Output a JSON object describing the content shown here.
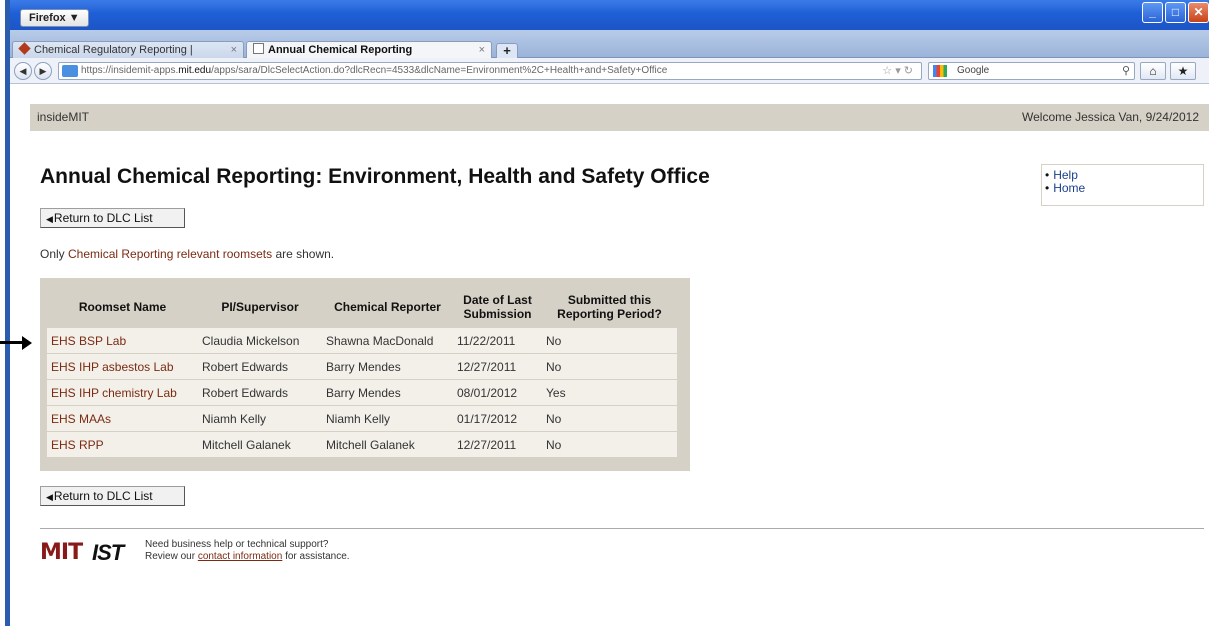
{
  "browser": {
    "menu_button": "Firefox ▼",
    "tabs": [
      {
        "label": "Chemical Regulatory Reporting |",
        "active": false
      },
      {
        "label": "Annual Chemical Reporting",
        "active": true
      }
    ],
    "new_tab": "+",
    "url_prefix": "https://insidemit-apps.",
    "url_host": "mit.edu",
    "url_path": "/apps/sara/DlcSelectAction.do?dlcRecn=4533&dlcName=Environment%2C+Health+and+Safety+Office",
    "search_engine": "Google"
  },
  "header": {
    "brand": "insideMIT",
    "welcome": "Welcome Jessica Van, 9/24/2012"
  },
  "page": {
    "title": "Annual Chemical Reporting: Environment, Health and Safety Office",
    "help_links": [
      "Help",
      "Home"
    ],
    "return_button": "Return to DLC List",
    "note_prefix": "Only ",
    "note_link": "Chemical Reporting relevant roomsets",
    "note_suffix": " are shown."
  },
  "table": {
    "headers": {
      "roomset": "Roomset Name",
      "pi": "PI/Supervisor",
      "reporter": "Chemical Reporter",
      "date_1": "Date of Last",
      "date_2": "Submission",
      "submitted_1": "Submitted this",
      "submitted_2": "Reporting Period?"
    },
    "rows": [
      {
        "roomset": "EHS BSP Lab",
        "pi": "Claudia Mickelson",
        "reporter": "Shawna MacDonald",
        "date": "11/22/2011",
        "submitted": "No"
      },
      {
        "roomset": "EHS IHP asbestos Lab",
        "pi": "Robert Edwards",
        "reporter": "Barry Mendes",
        "date": "12/27/2011",
        "submitted": "No"
      },
      {
        "roomset": "EHS IHP chemistry Lab",
        "pi": "Robert Edwards",
        "reporter": "Barry Mendes",
        "date": "08/01/2012",
        "submitted": "Yes"
      },
      {
        "roomset": "EHS MAAs",
        "pi": "Niamh Kelly",
        "reporter": "Niamh Kelly",
        "date": "01/17/2012",
        "submitted": "No"
      },
      {
        "roomset": "EHS RPP",
        "pi": "Mitchell Galanek",
        "reporter": "Mitchell Galanek",
        "date": "12/27/2011",
        "submitted": "No"
      }
    ]
  },
  "footer": {
    "mit_logo": "MIT",
    "ist_logo": "IST",
    "line1": "Need business help or technical support?",
    "line2_prefix": "Review our ",
    "line2_link": "contact information",
    "line2_suffix": " for assistance."
  },
  "colors": {
    "header_bg": "#d6d1c6",
    "link": "#7a2b12",
    "row_bg": "#f3f0ea"
  }
}
